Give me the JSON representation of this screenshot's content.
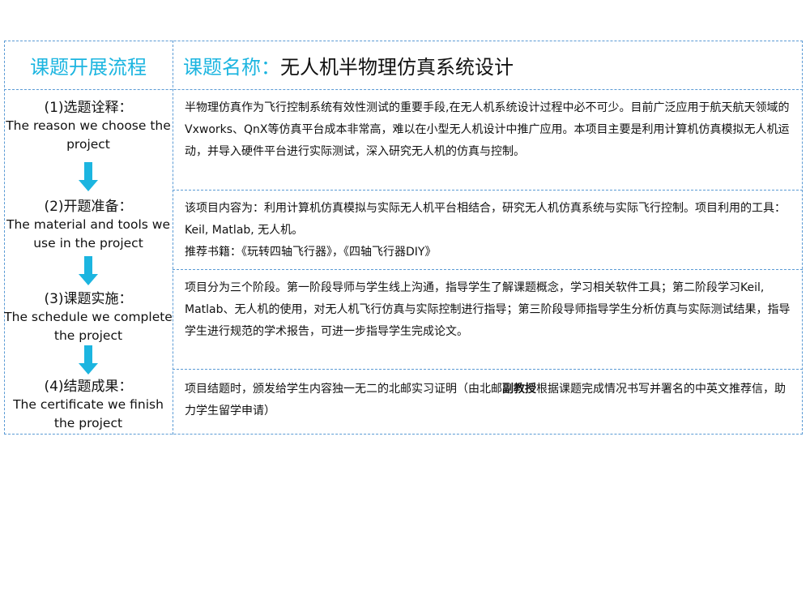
{
  "header": {
    "left_title": "课题开展流程",
    "right_label": "课题名称：",
    "right_title": "无人机半物理仿真系统设计"
  },
  "steps": [
    {
      "cn": "(1)选题诠释：",
      "en": "The reason we choose the project"
    },
    {
      "cn": "(2)开题准备：",
      "en": "The material and tools we use in the project"
    },
    {
      "cn": "(3)课题实施：",
      "en": "The schedule we complete the project"
    },
    {
      "cn": "(4)结题成果：",
      "en": "The certificate we finish the project"
    }
  ],
  "sections": [
    {
      "text": "半物理仿真作为飞行控制系统有效性测试的重要手段,在无人机系统设计过程中必不可少。目前广泛应用于航天航天领域的Vxworks、QnX等仿真平台成本非常高，难以在小型无人机设计中推广应用。本项目主要是利用计算机仿真模拟无人机运动，并导入硬件平台进行实际测试，深入研究无人机的仿真与控制。"
    },
    {
      "text": "该项目内容为：利用计算机仿真模拟与实际无人机平台相结合，研究无人机仿真系统与实际飞行控制。项目利用的工具：Keil, Matlab, 无人机。",
      "books": "推荐书籍：《玩转四轴飞行器》，《四轴飞行器DIY》"
    },
    {
      "text": "项目分为三个阶段。第一阶段导师与学生线上沟通，指导学生了解课题概念，学习相关软件工具；第二阶段学习Keil, Matlab、无人机的使用，对无人机飞行仿真与实际控制进行指导；第三阶段导师指导学生分析仿真与实际测试结果，指导学生进行规范的学术报告，可进一步指导学生完成论文。"
    },
    {
      "text_before": "项目结题时，颁发给学生内容独一无二的北邮实习证明（由北邮",
      "text_bold": "副教授",
      "text_after": "根据课题完成情况书写并署名的中英文推荐信，助力学生留学申请）"
    }
  ],
  "colors": {
    "accent": "#1cb5e0",
    "border": "#5b9bd5"
  }
}
